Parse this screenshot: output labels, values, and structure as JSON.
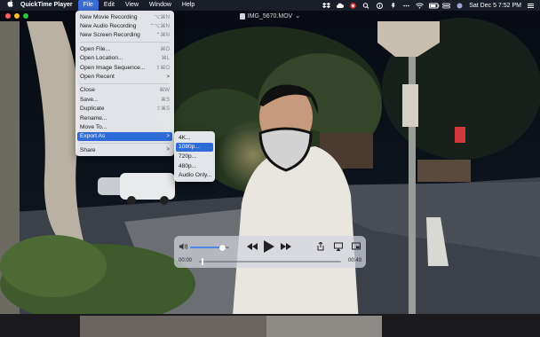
{
  "menubar": {
    "app_name": "QuickTime Player",
    "menus": [
      "File",
      "Edit",
      "View",
      "Window",
      "Help"
    ],
    "clock": "Sat Dec 5  7:52 PM"
  },
  "window": {
    "title": "IMG_5670.MOV",
    "title_suffix": "⌄"
  },
  "file_menu": {
    "items": [
      {
        "label": "New Movie Recording",
        "shortcut": "⌥⌘N"
      },
      {
        "label": "New Audio Recording",
        "shortcut": "⌃⌥⌘N"
      },
      {
        "label": "New Screen Recording",
        "shortcut": "⌃⌘N"
      },
      {
        "label": "Open File...",
        "shortcut": "⌘O"
      },
      {
        "label": "Open Location...",
        "shortcut": "⌘L"
      },
      {
        "label": "Open Image Sequence...",
        "shortcut": "⇧⌘O"
      },
      {
        "label": "Open Recent",
        "shortcut": ">"
      },
      {
        "label": "Close",
        "shortcut": "⌘W"
      },
      {
        "label": "Save...",
        "shortcut": "⌘S"
      },
      {
        "label": "Duplicate",
        "shortcut": "⇧⌘S"
      },
      {
        "label": "Rename...",
        "shortcut": ""
      },
      {
        "label": "Move To...",
        "shortcut": ""
      },
      {
        "label": "Export As",
        "shortcut": ">"
      },
      {
        "label": "Share",
        "shortcut": ">"
      }
    ]
  },
  "export_menu": {
    "items": [
      "4K...",
      "1080p...",
      "720p...",
      "480p...",
      "Audio Only..."
    ],
    "selected": "1080p..."
  },
  "player": {
    "current_time": "00:00",
    "duration": "00:49",
    "volume_level": 0.82,
    "progress": 0.02
  },
  "colors": {
    "highlight": "#2f6bd6",
    "close": "#ff5f57",
    "minimize": "#febc2e",
    "zoom": "#28c840",
    "accent": "#4f87e6"
  },
  "icons": [
    "apple-icon",
    "volume-icon",
    "rewind-icon",
    "play-icon",
    "fast-forward-icon",
    "share-icon",
    "airplay-icon",
    "picture-in-picture-icon"
  ]
}
